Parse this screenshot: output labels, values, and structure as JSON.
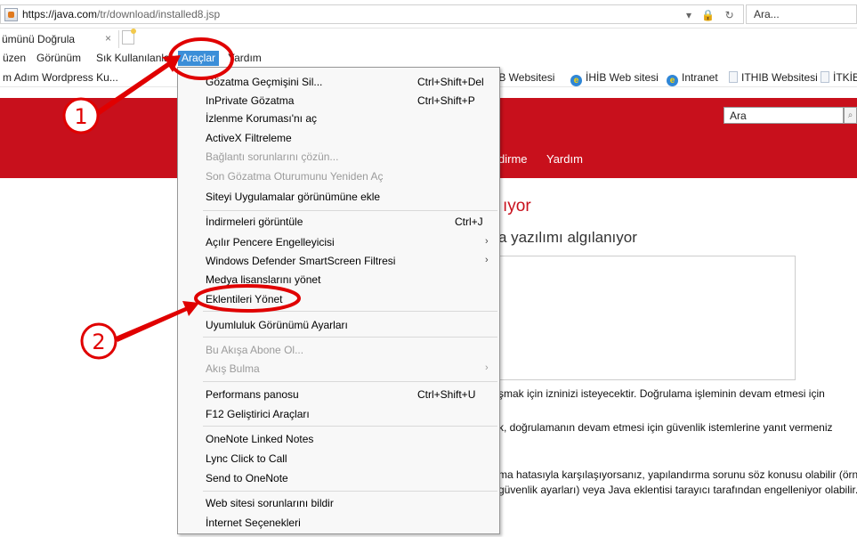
{
  "address_bar": {
    "url_host": "https://java.com",
    "url_path": "/tr/download/installed8.jsp",
    "controls": "▾ 🔒 ↻",
    "search_placeholder": "Ara..."
  },
  "tabs": [
    {
      "title": "ümünü Doğrula",
      "close": "×"
    }
  ],
  "menubar": {
    "items": [
      "üzen",
      "Görünüm",
      "Sık Kullanılanlar",
      "Araçlar",
      "Yardım"
    ]
  },
  "favorites": {
    "items": [
      {
        "label": "m Adım Wordpress Ku...",
        "icon": "ie-icon"
      },
      {
        "label": "İHİB Websitesi",
        "icon": "ie-icon"
      },
      {
        "label": "İHİB Web sitesi",
        "icon": "ie-icon"
      },
      {
        "label": "Intranet",
        "icon": "ie-icon"
      },
      {
        "label": "ITHIB Websitesi",
        "icon": "page-icon"
      },
      {
        "label": "İTKİB",
        "icon": "page-icon"
      }
    ]
  },
  "page": {
    "search_placeholder": "Ara",
    "nav": [
      "dirme",
      "Yardım"
    ],
    "title": "ıyor",
    "subtitle": "a yazılımı algılanıyor",
    "paragraphs": [
      "şmak için izninizi isteyecektir. Doğrulama işleminin devam etmesi için",
      "k, doğrulamanın devam etmesi için güvenlik istemlerine yanıt vermeniz",
      "ma hatasıyla karşılaşıyorsanız, yapılandırma sorunu söz konusu olabilir (örn.",
      "güvenlik ayarları) veya Java eklentisi tarayıcı tarafından engelleniyor olabilir."
    ]
  },
  "dropdown": {
    "items": [
      {
        "label": "Gözatma Geçmişini Sil...",
        "shortcut": "Ctrl+Shift+Del",
        "enabled": true
      },
      {
        "label": "InPrivate Gözatma",
        "shortcut": "Ctrl+Shift+P",
        "enabled": true
      },
      {
        "label": "İzlenme Koruması'nı aç",
        "enabled": true
      },
      {
        "label": "ActiveX Filtreleme",
        "enabled": true
      },
      {
        "label": "Bağlantı sorunlarını çözün...",
        "enabled": false
      },
      {
        "label": "Son Gözatma Oturumunu Yeniden Aç",
        "enabled": false
      },
      {
        "label": "Siteyi Uygulamalar görünümüne ekle",
        "enabled": true
      },
      {
        "label": "İndirmeleri görüntüle",
        "shortcut": "Ctrl+J",
        "enabled": true
      },
      {
        "label": "Açılır Pencere Engelleyicisi",
        "submenu": true,
        "enabled": true
      },
      {
        "label": "Windows Defender SmartScreen Filtresi",
        "submenu": true,
        "enabled": true
      },
      {
        "label": "Medya lisanslarını yönet",
        "enabled": true
      },
      {
        "label": "Eklentileri Yönet",
        "enabled": true
      },
      {
        "label": "Uyumluluk Görünümü Ayarları",
        "enabled": true
      },
      {
        "label": "Bu Akışa Abone Ol...",
        "enabled": false
      },
      {
        "label": "Akış Bulma",
        "submenu": true,
        "enabled": false
      },
      {
        "label": "Performans panosu",
        "shortcut": "Ctrl+Shift+U",
        "enabled": true
      },
      {
        "label": "F12 Geliştirici Araçları",
        "enabled": true
      },
      {
        "label": "OneNote Linked Notes",
        "enabled": true
      },
      {
        "label": "Lync Click to Call",
        "enabled": true
      },
      {
        "label": "Send to OneNote",
        "enabled": true
      },
      {
        "label": "Web sitesi sorunlarını bildir",
        "enabled": true
      },
      {
        "label": "İnternet Seçenekleri",
        "enabled": true
      }
    ],
    "submenu_arrow": "›"
  },
  "annotations": {
    "step1": "1",
    "step2": "2",
    "color": "#e00000"
  }
}
